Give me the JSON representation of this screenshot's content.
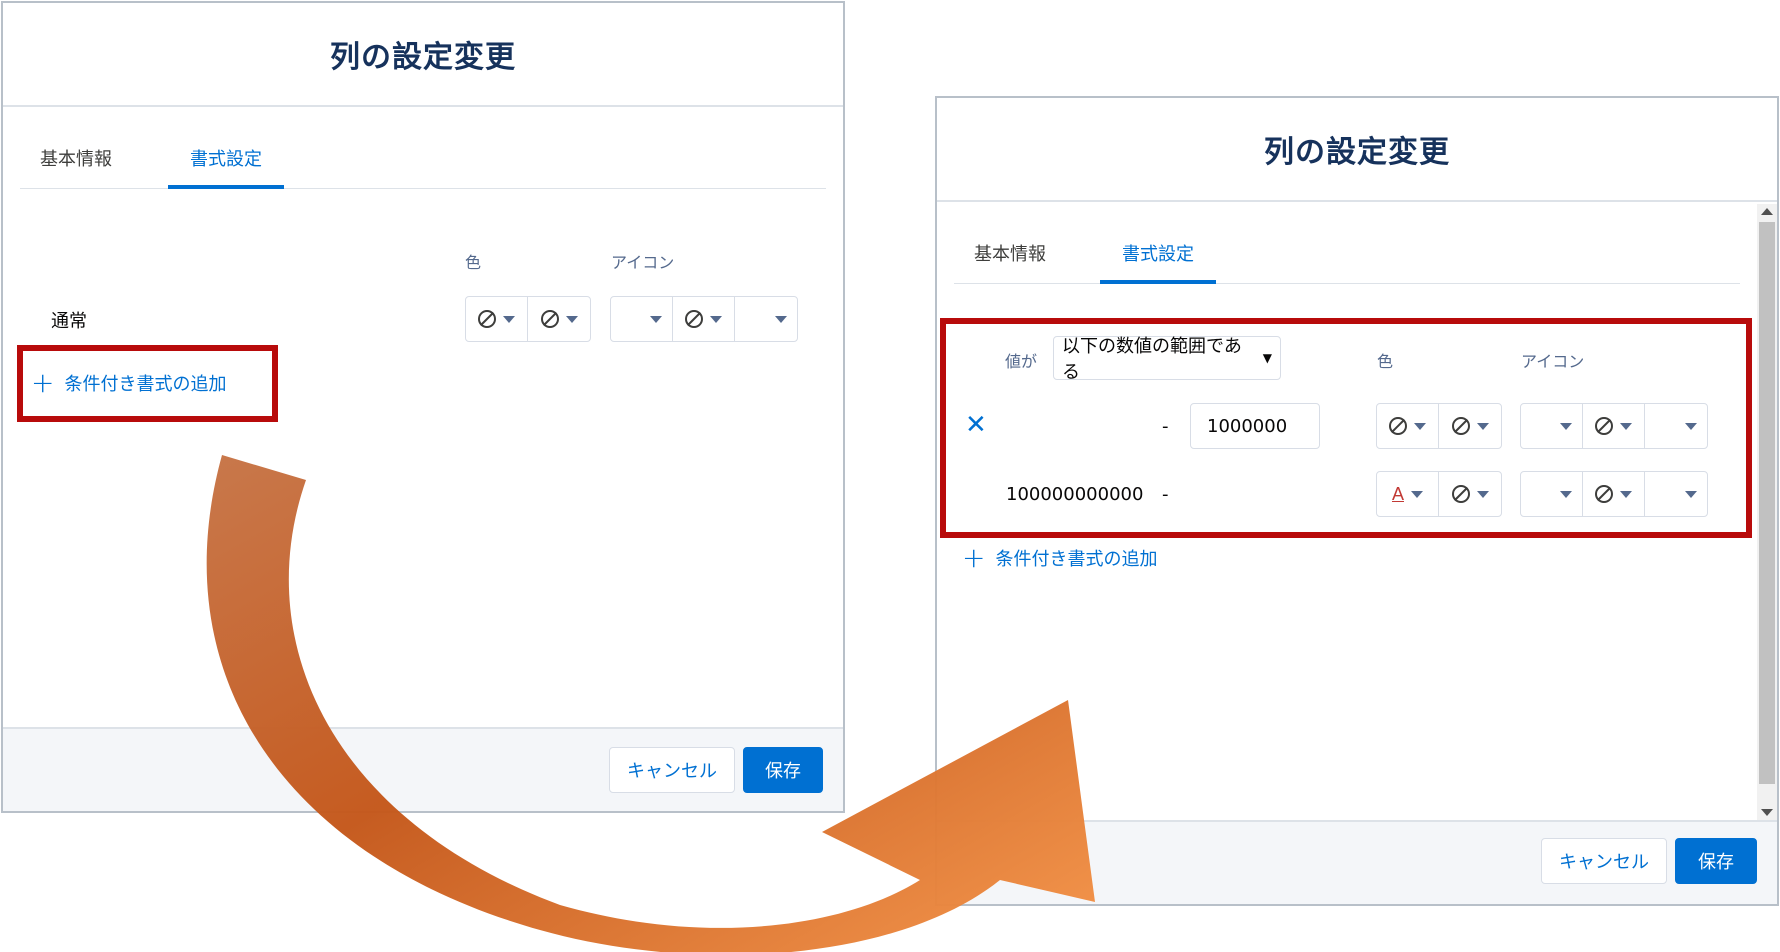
{
  "left_modal": {
    "title": "列の設定変更",
    "tabs": [
      "基本情報",
      "書式設定"
    ],
    "active_tab": "書式設定",
    "columns": {
      "color": "色",
      "icon": "アイコン"
    },
    "rows": [
      {
        "label": "通常"
      }
    ],
    "add_conditional": "条件付き書式の追加",
    "footer": {
      "cancel": "キャンセル",
      "save": "保存"
    }
  },
  "right_modal": {
    "title": "列の設定変更",
    "tabs": [
      "基本情報",
      "書式設定"
    ],
    "active_tab": "書式設定",
    "condition": {
      "prefix": "値が",
      "operator": "以下の数値の範囲である"
    },
    "columns": {
      "color": "色",
      "icon": "アイコン"
    },
    "rules": [
      {
        "from": "",
        "dash": "-",
        "to": "1000000",
        "text_color_icon": "ban-icon"
      },
      {
        "from": "100000000000",
        "dash": "-",
        "to": "",
        "text_color_icon": "text-color-a-icon"
      }
    ],
    "add_conditional": "条件付き書式の追加",
    "footer": {
      "cancel": "キャンセル",
      "save": "保存"
    }
  },
  "colors": {
    "brand": "#0070d2",
    "highlight": "#b80b0b",
    "arrow_light": "#f5a25a",
    "arrow_dark": "#c4571a",
    "red_text": "#c23934"
  }
}
